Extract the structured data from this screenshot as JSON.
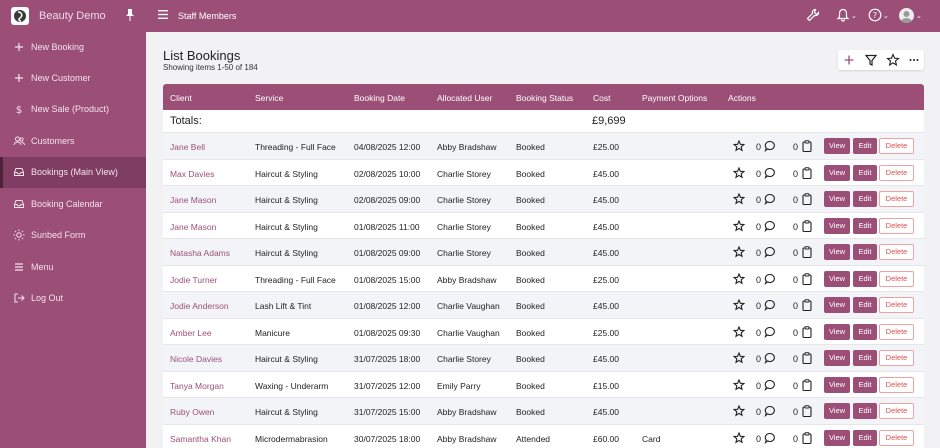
{
  "app": {
    "name": "Beauty Demo",
    "section_title": "Staff Members"
  },
  "colors": {
    "brand": "#9b4f77",
    "brand_dark": "#7f3e61",
    "link": "#9b4f77",
    "delete": "#d9534f"
  },
  "topbar": {
    "icons": [
      "wrench-icon",
      "bell-icon",
      "help-icon",
      "user-avatar"
    ]
  },
  "sidebar": {
    "items": [
      {
        "label": "New Booking",
        "icon": "plus-icon"
      },
      {
        "label": "New Customer",
        "icon": "plus-icon"
      },
      {
        "label": "New Sale (Product)",
        "icon": "dollar-icon"
      },
      {
        "label": "Customers",
        "icon": "users-icon"
      },
      {
        "label": "Bookings (Main View)",
        "icon": "inbox-icon",
        "active": true
      },
      {
        "label": "Booking Calendar",
        "icon": "inbox-icon"
      },
      {
        "label": "Sunbed Form",
        "icon": "sun-icon"
      },
      {
        "label": "Menu",
        "icon": "hamburger-icon"
      },
      {
        "label": "Log Out",
        "icon": "logout-icon"
      }
    ]
  },
  "page": {
    "title": "List Bookings",
    "subtitle": "Showing items 1-50 of 184"
  },
  "toolbar": {
    "icons": [
      "plus-icon",
      "filter-icon",
      "star-icon",
      "more-icon"
    ]
  },
  "table": {
    "columns": [
      "Client",
      "Service",
      "Booking Date",
      "Allocated User",
      "Booking Status",
      "Cost",
      "Payment Options",
      "Actions"
    ],
    "totals_label": "Totals:",
    "totals_cost": "£9,699",
    "buttons": {
      "view": "View",
      "edit": "Edit",
      "delete": "Delete"
    },
    "rows": [
      {
        "client": "Jane Bell",
        "service": "Threading - Full Face",
        "date": "04/08/2025 12:00",
        "user": "Abby Bradshaw",
        "status": "Booked",
        "cost": "£25.00",
        "payment": "",
        "comments": "0",
        "notes": "0"
      },
      {
        "client": "Max Davies",
        "service": "Haircut & Styling",
        "date": "02/08/2025 10:00",
        "user": "Charlie Storey",
        "status": "Booked",
        "cost": "£45.00",
        "payment": "",
        "comments": "0",
        "notes": "0"
      },
      {
        "client": "Jane Mason",
        "service": "Haircut & Styling",
        "date": "02/08/2025 09:00",
        "user": "Charlie Storey",
        "status": "Booked",
        "cost": "£45.00",
        "payment": "",
        "comments": "0",
        "notes": "0"
      },
      {
        "client": "Jane Mason",
        "service": "Haircut & Styling",
        "date": "01/08/2025 11:00",
        "user": "Charlie Storey",
        "status": "Booked",
        "cost": "£45.00",
        "payment": "",
        "comments": "0",
        "notes": "0"
      },
      {
        "client": "Natasha Adams",
        "service": "Haircut & Styling",
        "date": "01/08/2025 09:00",
        "user": "Charlie Storey",
        "status": "Booked",
        "cost": "£45.00",
        "payment": "",
        "comments": "0",
        "notes": "0"
      },
      {
        "client": "Jodie Turner",
        "service": "Threading - Full Face",
        "date": "01/08/2025 15:00",
        "user": "Abby Bradshaw",
        "status": "Booked",
        "cost": "£25.00",
        "payment": "",
        "comments": "0",
        "notes": "0"
      },
      {
        "client": "Jodie Anderson",
        "service": "Lash Lift & Tint",
        "date": "01/08/2025 12:00",
        "user": "Charlie Vaughan",
        "status": "Booked",
        "cost": "£45.00",
        "payment": "",
        "comments": "0",
        "notes": "0"
      },
      {
        "client": "Amber Lee",
        "service": "Manicure",
        "date": "01/08/2025 09:30",
        "user": "Charlie Vaughan",
        "status": "Booked",
        "cost": "£25.00",
        "payment": "",
        "comments": "0",
        "notes": "0"
      },
      {
        "client": "Nicole Davies",
        "service": "Haircut & Styling",
        "date": "31/07/2025 18:00",
        "user": "Charlie Storey",
        "status": "Booked",
        "cost": "£45.00",
        "payment": "",
        "comments": "0",
        "notes": "0"
      },
      {
        "client": "Tanya Morgan",
        "service": "Waxing - Underarm",
        "date": "31/07/2025 12:00",
        "user": "Emily Parry",
        "status": "Booked",
        "cost": "£15.00",
        "payment": "",
        "comments": "0",
        "notes": "0"
      },
      {
        "client": "Ruby Owen",
        "service": "Haircut & Styling",
        "date": "31/07/2025 15:00",
        "user": "Abby Bradshaw",
        "status": "Booked",
        "cost": "£45.00",
        "payment": "",
        "comments": "0",
        "notes": "0"
      },
      {
        "client": "Samantha Khan",
        "service": "Microdermabrasion",
        "date": "30/07/2025 18:00",
        "user": "Abby Bradshaw",
        "status": "Attended",
        "cost": "£60.00",
        "payment": "Card",
        "comments": "0",
        "notes": "0"
      }
    ]
  }
}
